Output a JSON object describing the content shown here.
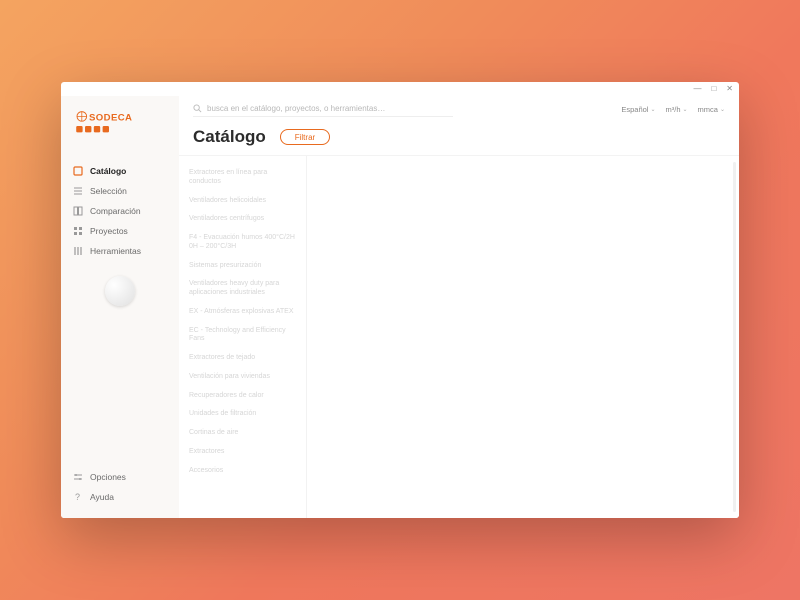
{
  "brand": "SODECA",
  "window": {
    "min": "—",
    "max": "□",
    "close": "✕"
  },
  "search": {
    "placeholder": "busca en el catálogo, proyectos, o herramientas…"
  },
  "dropdowns": {
    "lang": "Español",
    "unit1": "m³/h",
    "unit2": "mmca"
  },
  "page": {
    "title": "Catálogo",
    "filter": "Filtrar"
  },
  "nav": [
    {
      "label": "Catálogo",
      "active": true
    },
    {
      "label": "Selección"
    },
    {
      "label": "Comparación"
    },
    {
      "label": "Proyectos"
    },
    {
      "label": "Herramientas"
    }
  ],
  "footer": [
    {
      "label": "Opciones"
    },
    {
      "label": "Ayuda"
    }
  ],
  "categories": [
    "Extractores en línea para conductos",
    "Ventiladores helicoidales",
    "Ventiladores centrífugos",
    "F4 - Evacuación humos 400°C/2H 0H – 200°C/3H",
    "Sistemas presurización",
    "Ventiladores heavy duty para aplicaciones industriales",
    "EX - Atmósferas explosivas ATEX",
    "EC - Technology and Efficiency Fans",
    "Extractores de tejado",
    "Ventilación para viviendas",
    "Recuperadores de calor",
    "Unidades de filtración",
    "Cortinas de aire",
    "Extractores",
    "Accesorios"
  ]
}
